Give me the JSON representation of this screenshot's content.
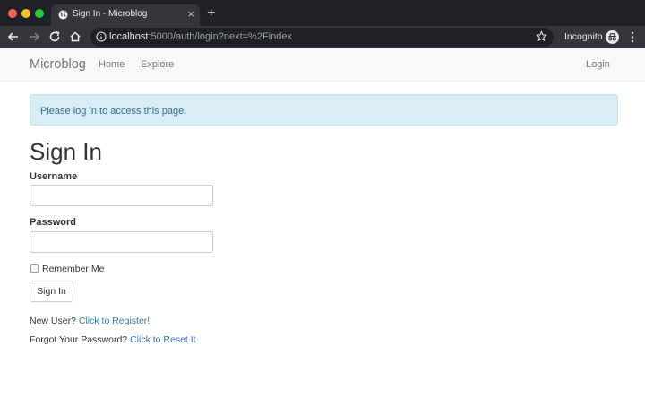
{
  "browser": {
    "tab_title": "Sign In - Microblog",
    "tab_close": "×",
    "new_tab": "+",
    "url_host": "localhost",
    "url_path": ":5000/auth/login?next=%2Findex",
    "incognito_label": "Incognito"
  },
  "navbar": {
    "brand": "Microblog",
    "links": [
      "Home",
      "Explore"
    ],
    "login": "Login"
  },
  "alert": {
    "message": "Please log in to access this page."
  },
  "form": {
    "title": "Sign In",
    "username_label": "Username",
    "username_value": "",
    "password_label": "Password",
    "password_value": "",
    "remember_label": "Remember Me",
    "remember_checked": false,
    "submit_label": "Sign In"
  },
  "footer_links": {
    "register_prefix": "New User?",
    "register_link": "Click to Register!",
    "reset_prefix": "Forgot Your Password?",
    "reset_link": "Click to Reset It"
  },
  "colors": {
    "alert_bg": "#d9edf7",
    "alert_text": "#31708f",
    "link": "#337ab7",
    "navbar_bg": "#f8f8f8"
  }
}
